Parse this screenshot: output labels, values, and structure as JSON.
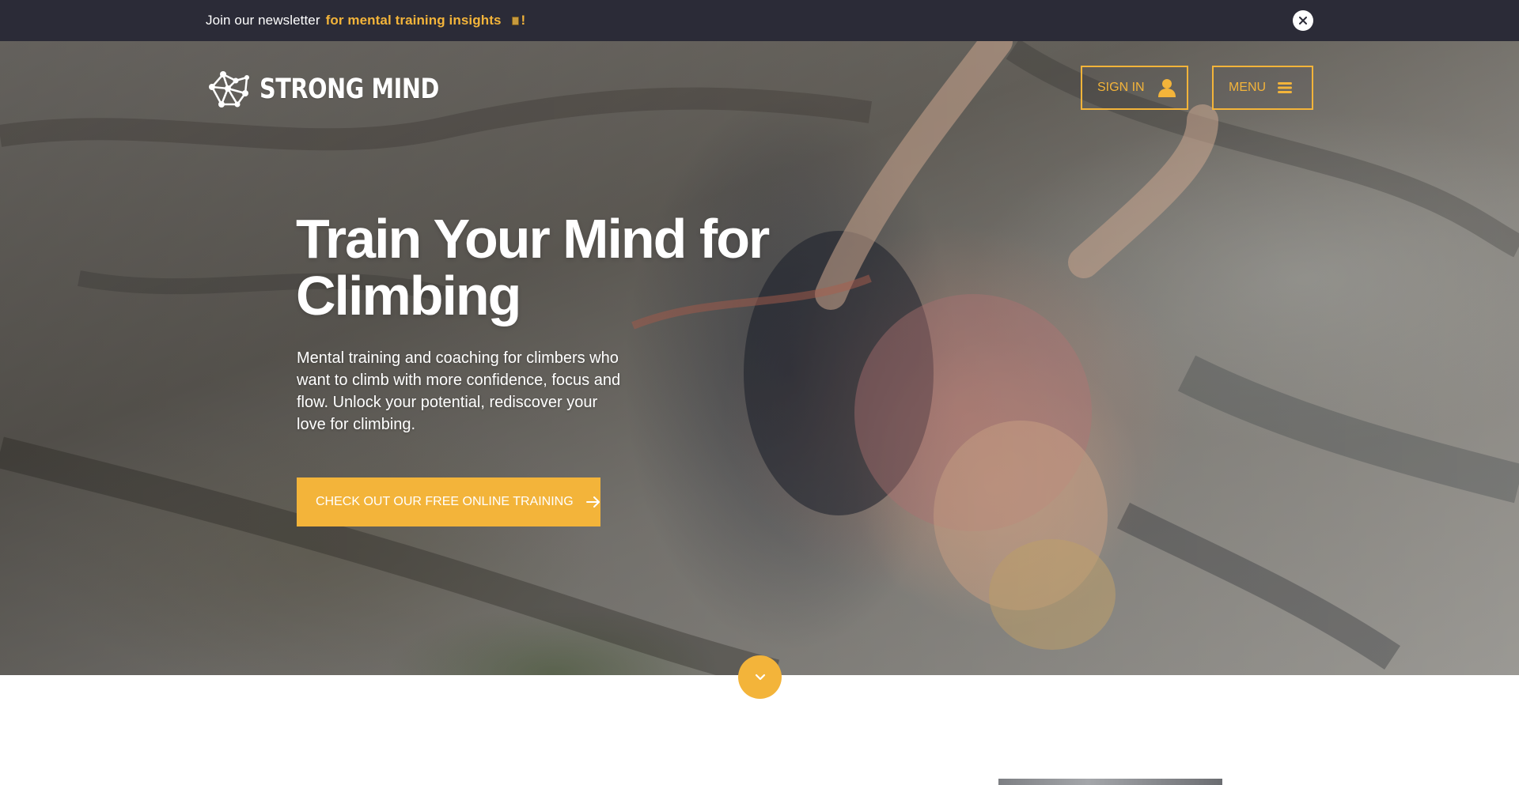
{
  "newsletter": {
    "prefix": "Join our newsletter",
    "highlight": "for mental training insights",
    "suffix": "!",
    "close_icon": "close-icon"
  },
  "header": {
    "logo_text": "STRONG MIND",
    "logo_icon": "network-nodes-icon",
    "signin_label": "SIGN IN",
    "signin_icon": "user-icon",
    "menu_label": "MENU",
    "menu_icon": "hamburger-icon"
  },
  "hero": {
    "title_line1": "Train Your Mind for",
    "title_line2": "Climbing",
    "subtitle": "Mental training and coaching for climbers who want to climb with more confidence, focus and flow. Unlock your potential, rediscover your love for climbing.",
    "cta_label": "CHECK OUT OUR FREE ONLINE TRAINING",
    "cta_icon": "arrow-right-icon",
    "scroll_icon": "chevron-down-icon"
  },
  "colors": {
    "accent": "#f3b43a",
    "topbar_bg": "#2b2b37",
    "text_light": "#ffffff"
  }
}
